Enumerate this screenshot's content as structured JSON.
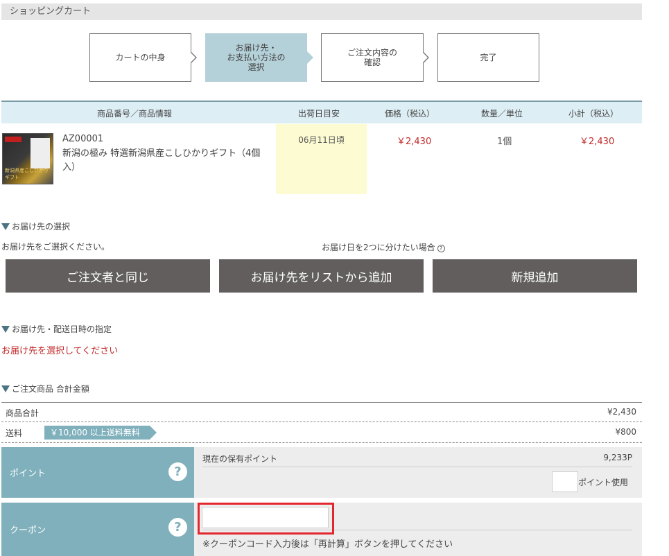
{
  "page": {
    "title": "ショッピングカート"
  },
  "steps": [
    {
      "label": "カートの中身",
      "active": false
    },
    {
      "label": "お届け先・\nお支払い方法の\n選択",
      "active": true
    },
    {
      "label": "ご注文内容の\n確認",
      "active": false
    },
    {
      "label": "完了",
      "active": false
    }
  ],
  "cart": {
    "headers": {
      "product": "商品番号／商品情報",
      "ship_date": "出荷日目安",
      "price": "価格（税込）",
      "qty": "数量／単位",
      "subtotal": "小計（税込）"
    },
    "items": [
      {
        "sku": "AZ00001",
        "name": "新潟の極み 特選新潟県産こしひかりギフト（4個入）",
        "ship_date": "06月11日頃",
        "price": "￥2,430",
        "qty": "1個",
        "subtotal": "￥2,430"
      }
    ]
  },
  "delivery_select": {
    "heading": "お届け先の選択",
    "prompt": "お届け先をご選択ください。",
    "split_note": "お届け日を2つに分けたい場合",
    "help_glyph": "?",
    "buttons": {
      "same": "ご注文者と同じ",
      "from_list": "お届け先をリストから追加",
      "new": "新規追加"
    }
  },
  "delivery_date": {
    "heading": "お届け先・配送日時の指定",
    "error": "お届け先を選択してください"
  },
  "totals": {
    "heading": "ご注文商品 合計金額",
    "subtotal_label": "商品合計",
    "subtotal_value": "¥2,430",
    "shipping_label": "送料",
    "shipping_badge": "￥10,000 以上送料無料",
    "shipping_value": "¥800"
  },
  "points": {
    "label": "ポイント",
    "held_label": "現在の保有ポイント",
    "held_value": "9,233P",
    "use_label": "ポイント使用",
    "help_glyph": "?"
  },
  "coupon": {
    "label": "クーポン",
    "note": "※クーポンコード入力後は「再計算」ボタンを押してください",
    "help_glyph": "?"
  },
  "thumb": {
    "caption": "新潟県産こしひかりギフト"
  },
  "colors": {
    "accent": "#7fb0bc",
    "button": "#625e5e",
    "error": "#c12a2a",
    "highlight": "#e3262d"
  }
}
